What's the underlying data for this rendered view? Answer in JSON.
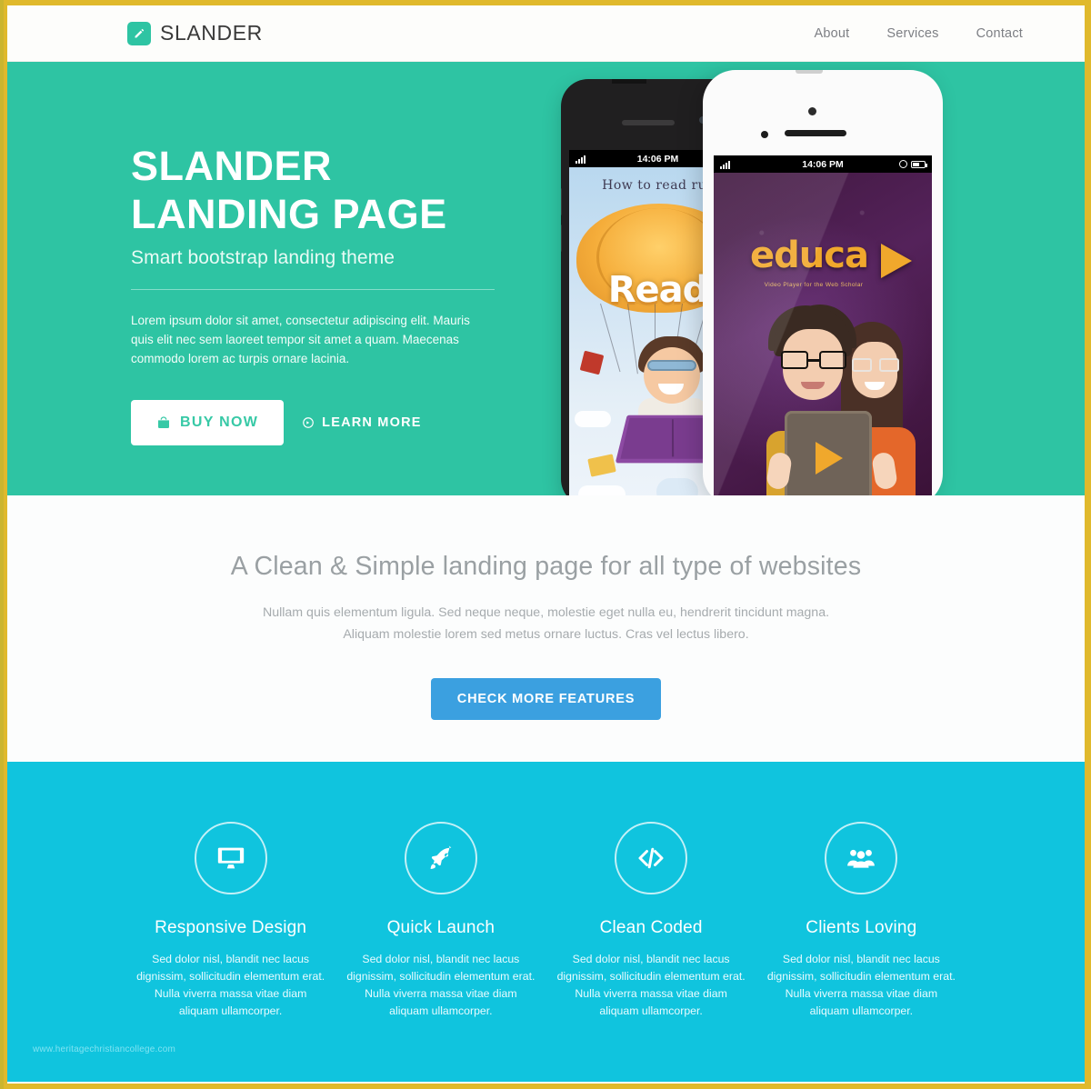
{
  "theme": {
    "frame_color": "#e0b92c",
    "hero_bg": "#2ec4a3",
    "features_bg": "#10c4de",
    "cta_blue": "#3ba0e0",
    "nav_bg": "#fdfdfb"
  },
  "navbar": {
    "brand": "SLANDER",
    "brand_icon": "pencil-icon",
    "links": [
      {
        "label": "About"
      },
      {
        "label": "Services"
      },
      {
        "label": "Contact"
      }
    ]
  },
  "hero": {
    "title_line1": "SLANDER",
    "title_line2": "LANDING PAGE",
    "subtitle": "Smart bootstrap landing theme",
    "paragraph": "Lorem ipsum dolor sit amet, consectetur adipiscing elit. Mauris quis elit nec sem laoreet tempor sit amet a quam. Maecenas commodo lorem ac turpis ornare lacinia.",
    "buy_button": "BUY NOW",
    "buy_icon": "shopping-bag-icon",
    "learn_button": "LEARN MORE",
    "learn_icon": "circle-arrow-icon",
    "phone_dark": {
      "status_time": "14:06 PM",
      "app_heading": "How to read rus",
      "app_word": "Read"
    },
    "phone_light": {
      "status_time": "14:06 PM",
      "app_word": "educa",
      "app_tagline": "Video Player for the Web Scholar"
    }
  },
  "intro": {
    "title": "A Clean & Simple landing page for all type of websites",
    "paragraph_line1": "Nullam quis elementum ligula. Sed neque neque, molestie eget nulla eu, hendrerit tincidunt magna.",
    "paragraph_line2": "Aliquam molestie lorem sed metus ornare luctus. Cras vel lectus libero.",
    "cta_button": "CHECK MORE FEATURES"
  },
  "features": {
    "items": [
      {
        "icon": "monitor-icon",
        "title": "Responsive Design",
        "text": "Sed dolor nisl, blandit nec lacus dignissim, sollicitudin elementum erat. Nulla viverra massa vitae diam aliquam ullamcorper."
      },
      {
        "icon": "rocket-icon",
        "title": "Quick Launch",
        "text": "Sed dolor nisl, blandit nec lacus dignissim, sollicitudin elementum erat. Nulla viverra massa vitae diam aliquam ullamcorper."
      },
      {
        "icon": "code-icon",
        "title": "Clean Coded",
        "text": "Sed dolor nisl, blandit nec lacus dignissim, sollicitudin elementum erat. Nulla viverra massa vitae diam aliquam ullamcorper."
      },
      {
        "icon": "users-group-icon",
        "title": "Clients Loving",
        "text": "Sed dolor nisl, blandit nec lacus dignissim, sollicitudin elementum erat. Nulla viverra massa vitae diam aliquam ullamcorper."
      }
    ],
    "watermark": "www.heritagechristiancollege.com"
  }
}
